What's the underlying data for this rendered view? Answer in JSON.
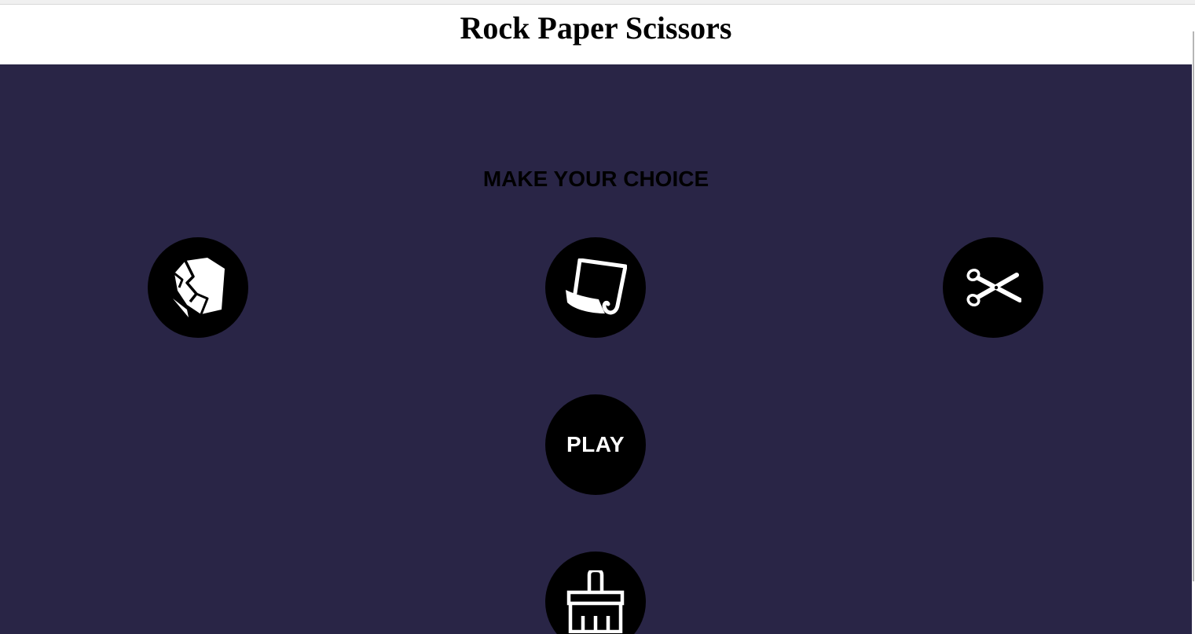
{
  "header": {
    "title": "Rock Paper Scissors"
  },
  "main": {
    "prompt": "MAKE YOUR CHOICE",
    "choices": [
      {
        "name": "rock",
        "icon": "rock-icon"
      },
      {
        "name": "paper",
        "icon": "paper-icon"
      },
      {
        "name": "scissors",
        "icon": "scissors-icon"
      }
    ],
    "play_label": "PLAY",
    "reset_icon": "brush-icon"
  },
  "colors": {
    "background": "#292546",
    "button": "#000000",
    "icon": "#ffffff",
    "header_background": "#ffffff"
  }
}
